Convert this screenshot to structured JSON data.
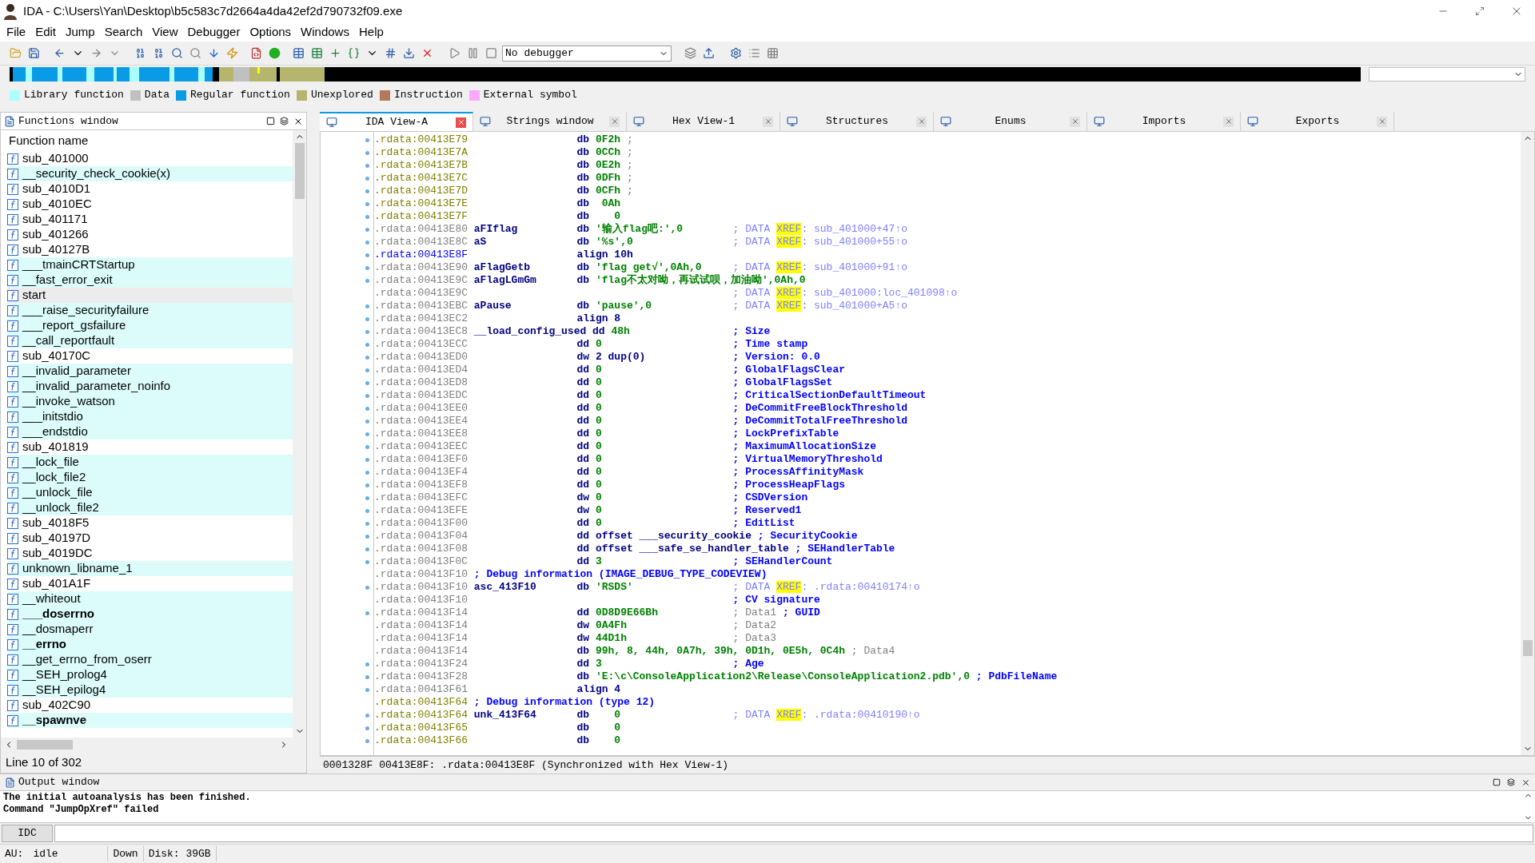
{
  "window": {
    "title": "IDA - C:\\Users\\Yan\\Desktop\\b5c583c7d2664a4da42ef2d790732f09.exe"
  },
  "menu": [
    "File",
    "Edit",
    "Jump",
    "Search",
    "View",
    "Debugger",
    "Options",
    "Windows",
    "Help"
  ],
  "toolbar": {
    "debugger_select": "No debugger"
  },
  "legend": [
    {
      "label": "Library function",
      "color": "#aaffff"
    },
    {
      "label": "Data",
      "color": "#c0c0c0"
    },
    {
      "label": "Regular function",
      "color": "#0a9be6"
    },
    {
      "label": "Unexplored",
      "color": "#b5b56e"
    },
    {
      "label": "Instruction",
      "color": "#b4785a"
    },
    {
      "label": "External symbol",
      "color": "#ffa8ff"
    }
  ],
  "functions_window": {
    "title": "Functions window",
    "column": "Function name",
    "status": "Line 10 of 302",
    "items": [
      {
        "name": "sub_401000",
        "library": false,
        "bold": false,
        "selected": false
      },
      {
        "name": "__security_check_cookie(x)",
        "library": true,
        "bold": false,
        "selected": false
      },
      {
        "name": "sub_4010D1",
        "library": false,
        "bold": false,
        "selected": false
      },
      {
        "name": "sub_4010EC",
        "library": false,
        "bold": false,
        "selected": false
      },
      {
        "name": "sub_401171",
        "library": false,
        "bold": false,
        "selected": false
      },
      {
        "name": "sub_401266",
        "library": false,
        "bold": false,
        "selected": false
      },
      {
        "name": "sub_40127B",
        "library": false,
        "bold": false,
        "selected": false
      },
      {
        "name": "___tmainCRTStartup",
        "library": true,
        "bold": false,
        "selected": false
      },
      {
        "name": "__fast_error_exit",
        "library": true,
        "bold": false,
        "selected": false
      },
      {
        "name": "start",
        "library": false,
        "bold": false,
        "selected": true
      },
      {
        "name": "___raise_securityfailure",
        "library": true,
        "bold": false,
        "selected": false
      },
      {
        "name": "___report_gsfailure",
        "library": true,
        "bold": false,
        "selected": false
      },
      {
        "name": "__call_reportfault",
        "library": true,
        "bold": false,
        "selected": false
      },
      {
        "name": "sub_40170C",
        "library": false,
        "bold": false,
        "selected": false
      },
      {
        "name": "__invalid_parameter",
        "library": true,
        "bold": false,
        "selected": false
      },
      {
        "name": "__invalid_parameter_noinfo",
        "library": true,
        "bold": false,
        "selected": false
      },
      {
        "name": "__invoke_watson",
        "library": true,
        "bold": false,
        "selected": false
      },
      {
        "name": "___initstdio",
        "library": true,
        "bold": false,
        "selected": false
      },
      {
        "name": "___endstdio",
        "library": true,
        "bold": false,
        "selected": false
      },
      {
        "name": "sub_401819",
        "library": false,
        "bold": false,
        "selected": false
      },
      {
        "name": "__lock_file",
        "library": true,
        "bold": false,
        "selected": false
      },
      {
        "name": "__lock_file2",
        "library": true,
        "bold": false,
        "selected": false
      },
      {
        "name": "__unlock_file",
        "library": true,
        "bold": false,
        "selected": false
      },
      {
        "name": "__unlock_file2",
        "library": true,
        "bold": false,
        "selected": false
      },
      {
        "name": "sub_4018F5",
        "library": false,
        "bold": false,
        "selected": false
      },
      {
        "name": "sub_40197D",
        "library": false,
        "bold": false,
        "selected": false
      },
      {
        "name": "sub_4019DC",
        "library": false,
        "bold": false,
        "selected": false
      },
      {
        "name": "unknown_libname_1",
        "library": true,
        "bold": false,
        "selected": false
      },
      {
        "name": "sub_401A1F",
        "library": false,
        "bold": false,
        "selected": false
      },
      {
        "name": "__whiteout",
        "library": true,
        "bold": false,
        "selected": false
      },
      {
        "name": "___doserrno",
        "library": true,
        "bold": true,
        "selected": false
      },
      {
        "name": "__dosmaperr",
        "library": true,
        "bold": false,
        "selected": false
      },
      {
        "name": "__errno",
        "library": true,
        "bold": true,
        "selected": false
      },
      {
        "name": "__get_errno_from_oserr",
        "library": true,
        "bold": false,
        "selected": false
      },
      {
        "name": "__SEH_prolog4",
        "library": true,
        "bold": false,
        "selected": false
      },
      {
        "name": "__SEH_epilog4",
        "library": true,
        "bold": false,
        "selected": false
      },
      {
        "name": "sub_402C90",
        "library": false,
        "bold": false,
        "selected": false
      },
      {
        "name": "__spawnve",
        "library": true,
        "bold": true,
        "selected": false
      }
    ]
  },
  "tabs": [
    {
      "label": "IDA View-A",
      "selected": true
    },
    {
      "label": "Strings window",
      "selected": false
    },
    {
      "label": "Hex View-1",
      "selected": false
    },
    {
      "label": "Structures",
      "selected": false
    },
    {
      "label": "Enums",
      "selected": false
    },
    {
      "label": "Imports",
      "selected": false
    },
    {
      "label": "Exports",
      "selected": false
    }
  ],
  "listing": {
    "status": "0001328F 00413E8F: .rdata:00413E8F (Synchronized with Hex View-1)",
    "lines": [
      {
        "addr": ".rdata:00413E79",
        "unexplored": true,
        "cursor": false,
        "marker": true,
        "mnem": "db",
        "ops": "0F2h",
        "numeric": true,
        "inline": true,
        "comment": [
          {
            "kind": "plain",
            "text": ";"
          }
        ]
      },
      {
        "addr": ".rdata:00413E7A",
        "unexplored": true,
        "cursor": false,
        "marker": true,
        "mnem": "db",
        "ops": "0CCh",
        "numeric": true,
        "inline": true,
        "comment": [
          {
            "kind": "plain",
            "text": ";"
          }
        ]
      },
      {
        "addr": ".rdata:00413E7B",
        "unexplored": true,
        "cursor": false,
        "marker": true,
        "mnem": "db",
        "ops": "0E2h",
        "numeric": true,
        "inline": true,
        "comment": [
          {
            "kind": "plain",
            "text": ";"
          }
        ]
      },
      {
        "addr": ".rdata:00413E7C",
        "unexplored": true,
        "cursor": false,
        "marker": true,
        "mnem": "db",
        "ops": "0DFh",
        "numeric": true,
        "inline": true,
        "comment": [
          {
            "kind": "plain",
            "text": ";"
          }
        ]
      },
      {
        "addr": ".rdata:00413E7D",
        "unexplored": true,
        "cursor": false,
        "marker": true,
        "mnem": "db",
        "ops": "0CFh",
        "numeric": true,
        "inline": true,
        "comment": [
          {
            "kind": "plain",
            "text": ";"
          }
        ]
      },
      {
        "addr": ".rdata:00413E7E",
        "unexplored": true,
        "cursor": false,
        "marker": true,
        "mnem": "db",
        "ops": " 0Ah",
        "numeric": true
      },
      {
        "addr": ".rdata:00413E7F",
        "unexplored": true,
        "cursor": false,
        "marker": true,
        "mnem": "db",
        "ops": "   0",
        "numeric": true
      },
      {
        "addr": ".rdata:00413E80",
        "unexplored": false,
        "cursor": false,
        "marker": true,
        "label": "aFIflag",
        "mnem": "db",
        "ops": "'输入flag吧:',0",
        "numeric": true,
        "comment": [
          {
            "kind": "xref",
            "text": "; DATA "
          },
          {
            "kind": "xref_hl",
            "text": "XREF"
          },
          {
            "kind": "xref",
            "text": ": sub_401000+47↑o"
          }
        ]
      },
      {
        "addr": ".rdata:00413E8C",
        "unexplored": false,
        "cursor": false,
        "marker": true,
        "label": "aS",
        "mnem": "db",
        "ops": "'%s',0",
        "numeric": true,
        "comment": [
          {
            "kind": "xref",
            "text": "; DATA "
          },
          {
            "kind": "xref_hl",
            "text": "XREF"
          },
          {
            "kind": "xref",
            "text": ": sub_401000+55↑o"
          }
        ]
      },
      {
        "addr": ".rdata:00413E8F",
        "unexplored": false,
        "cursor": true,
        "marker": true,
        "mnem": "align",
        "ops": "10h",
        "numeric": false
      },
      {
        "addr": ".rdata:00413E90",
        "unexplored": false,
        "cursor": false,
        "marker": true,
        "label": "aFlagGetb",
        "mnem": "db",
        "ops": "'flag get√',0Ah,0",
        "numeric": true,
        "comment": [
          {
            "kind": "xref",
            "text": "; DATA "
          },
          {
            "kind": "xref_hl",
            "text": "XREF"
          },
          {
            "kind": "xref",
            "text": ": sub_401000+91↑o"
          }
        ]
      },
      {
        "addr": ".rdata:00413E9C",
        "unexplored": false,
        "cursor": false,
        "marker": true,
        "label": "aFlagLGmGm",
        "mnem": "db",
        "ops": "'flag不太对呦，再试试呗，加油呦',0Ah,0",
        "numeric": true
      },
      {
        "addr": ".rdata:00413E9C",
        "unexplored": false,
        "cursor": false,
        "marker": false,
        "comment": [
          {
            "kind": "xref",
            "text": "; DATA "
          },
          {
            "kind": "xref_hl",
            "text": "XREF"
          },
          {
            "kind": "xref",
            "text": ": sub_401000:loc_401098↑o"
          }
        ]
      },
      {
        "addr": ".rdata:00413EBC",
        "unexplored": false,
        "cursor": false,
        "marker": true,
        "label": "aPause",
        "mnem": "db",
        "ops": "'pause',0",
        "numeric": true,
        "comment": [
          {
            "kind": "xref",
            "text": "; DATA "
          },
          {
            "kind": "xref_hl",
            "text": "XREF"
          },
          {
            "kind": "xref",
            "text": ": sub_401000+A5↑o"
          }
        ]
      },
      {
        "addr": ".rdata:00413EC2",
        "unexplored": false,
        "cursor": false,
        "marker": true,
        "mnem": "align",
        "ops": "8",
        "numeric": false
      },
      {
        "addr": ".rdata:00413EC8",
        "unexplored": false,
        "cursor": false,
        "marker": true,
        "label": "__load_config_used",
        "mnem": "dd",
        "ops": "48h",
        "numeric": true,
        "comment": [
          {
            "kind": "struct",
            "text": "; Size"
          }
        ]
      },
      {
        "addr": ".rdata:00413ECC",
        "unexplored": false,
        "cursor": false,
        "marker": true,
        "mnem": "dd",
        "ops": "0",
        "numeric": true,
        "comment": [
          {
            "kind": "struct",
            "text": "; Time stamp"
          }
        ]
      },
      {
        "addr": ".rdata:00413ED0",
        "unexplored": false,
        "cursor": false,
        "marker": true,
        "mnem": "dw",
        "ops": "2 dup(0)",
        "numeric": false,
        "comment": [
          {
            "kind": "struct",
            "text": "; Version: 0.0"
          }
        ]
      },
      {
        "addr": ".rdata:00413ED4",
        "unexplored": false,
        "cursor": false,
        "marker": true,
        "mnem": "dd",
        "ops": "0",
        "numeric": true,
        "comment": [
          {
            "kind": "struct",
            "text": "; GlobalFlagsClear"
          }
        ]
      },
      {
        "addr": ".rdata:00413ED8",
        "unexplored": false,
        "cursor": false,
        "marker": true,
        "mnem": "dd",
        "ops": "0",
        "numeric": true,
        "comment": [
          {
            "kind": "struct",
            "text": "; GlobalFlagsSet"
          }
        ]
      },
      {
        "addr": ".rdata:00413EDC",
        "unexplored": false,
        "cursor": false,
        "marker": true,
        "mnem": "dd",
        "ops": "0",
        "numeric": true,
        "comment": [
          {
            "kind": "struct",
            "text": "; CriticalSectionDefaultTimeout"
          }
        ]
      },
      {
        "addr": ".rdata:00413EE0",
        "unexplored": false,
        "cursor": false,
        "marker": true,
        "mnem": "dd",
        "ops": "0",
        "numeric": true,
        "comment": [
          {
            "kind": "struct",
            "text": "; DeCommitFreeBlockThreshold"
          }
        ]
      },
      {
        "addr": ".rdata:00413EE4",
        "unexplored": false,
        "cursor": false,
        "marker": true,
        "mnem": "dd",
        "ops": "0",
        "numeric": true,
        "comment": [
          {
            "kind": "struct",
            "text": "; DeCommitTotalFreeThreshold"
          }
        ]
      },
      {
        "addr": ".rdata:00413EE8",
        "unexplored": false,
        "cursor": false,
        "marker": true,
        "mnem": "dd",
        "ops": "0",
        "numeric": true,
        "comment": [
          {
            "kind": "struct",
            "text": "; LockPrefixTable"
          }
        ]
      },
      {
        "addr": ".rdata:00413EEC",
        "unexplored": false,
        "cursor": false,
        "marker": true,
        "mnem": "dd",
        "ops": "0",
        "numeric": true,
        "comment": [
          {
            "kind": "struct",
            "text": "; MaximumAllocationSize"
          }
        ]
      },
      {
        "addr": ".rdata:00413EF0",
        "unexplored": false,
        "cursor": false,
        "marker": true,
        "mnem": "dd",
        "ops": "0",
        "numeric": true,
        "comment": [
          {
            "kind": "struct",
            "text": "; VirtualMemoryThreshold"
          }
        ]
      },
      {
        "addr": ".rdata:00413EF4",
        "unexplored": false,
        "cursor": false,
        "marker": true,
        "mnem": "dd",
        "ops": "0",
        "numeric": true,
        "comment": [
          {
            "kind": "struct",
            "text": "; ProcessAffinityMask"
          }
        ]
      },
      {
        "addr": ".rdata:00413EF8",
        "unexplored": false,
        "cursor": false,
        "marker": true,
        "mnem": "dd",
        "ops": "0",
        "numeric": true,
        "comment": [
          {
            "kind": "struct",
            "text": "; ProcessHeapFlags"
          }
        ]
      },
      {
        "addr": ".rdata:00413EFC",
        "unexplored": false,
        "cursor": false,
        "marker": true,
        "mnem": "dw",
        "ops": "0",
        "numeric": true,
        "comment": [
          {
            "kind": "struct",
            "text": "; CSDVersion"
          }
        ]
      },
      {
        "addr": ".rdata:00413EFE",
        "unexplored": false,
        "cursor": false,
        "marker": true,
        "mnem": "dw",
        "ops": "0",
        "numeric": true,
        "comment": [
          {
            "kind": "struct",
            "text": "; Reserved1"
          }
        ]
      },
      {
        "addr": ".rdata:00413F00",
        "unexplored": false,
        "cursor": false,
        "marker": true,
        "mnem": "dd",
        "ops": "0",
        "numeric": true,
        "comment": [
          {
            "kind": "struct",
            "text": "; EditList"
          }
        ]
      },
      {
        "addr": ".rdata:00413F04",
        "unexplored": false,
        "cursor": false,
        "marker": true,
        "mnem": "dd",
        "ops": "offset ___security_cookie",
        "numeric": false,
        "inline": true,
        "comment": [
          {
            "kind": "struct",
            "text": "; SecurityCookie"
          }
        ]
      },
      {
        "addr": ".rdata:00413F08",
        "unexplored": false,
        "cursor": false,
        "marker": true,
        "mnem": "dd",
        "ops": "offset ___safe_se_handler_table",
        "numeric": false,
        "inline": true,
        "comment": [
          {
            "kind": "struct",
            "text": "; SEHandlerTable"
          }
        ]
      },
      {
        "addr": ".rdata:00413F0C",
        "unexplored": false,
        "cursor": false,
        "marker": true,
        "mnem": "dd",
        "ops": "3",
        "numeric": true,
        "comment": [
          {
            "kind": "struct",
            "text": "; SEHandlerCount"
          }
        ]
      },
      {
        "addr": ".rdata:00413F10",
        "unexplored": false,
        "cursor": false,
        "marker": false,
        "header": "; Debug information (IMAGE_DEBUG_TYPE_CODEVIEW)"
      },
      {
        "addr": ".rdata:00413F10",
        "unexplored": false,
        "cursor": false,
        "marker": true,
        "label": "asc_413F10",
        "mnem": "db",
        "ops": "'RSDS'",
        "numeric": true,
        "comment": [
          {
            "kind": "xref",
            "text": "; DATA "
          },
          {
            "kind": "xref_hl",
            "text": "XREF"
          },
          {
            "kind": "xref",
            "text": ": .rdata:00410174↑o"
          }
        ]
      },
      {
        "addr": ".rdata:00413F10",
        "unexplored": false,
        "cursor": false,
        "marker": false,
        "comment": [
          {
            "kind": "struct",
            "text": "; CV signature"
          }
        ]
      },
      {
        "addr": ".rdata:00413F14",
        "unexplored": false,
        "cursor": false,
        "marker": true,
        "mnem": "dd",
        "ops": "0D8D9E66Bh",
        "numeric": true,
        "comment": [
          {
            "kind": "plain",
            "text": "; Data1"
          },
          {
            "kind": "struct",
            "text": " ; GUID"
          }
        ]
      },
      {
        "addr": ".rdata:00413F14",
        "unexplored": false,
        "cursor": false,
        "marker": false,
        "mnem": "dw",
        "ops": "0A4Fh",
        "numeric": true,
        "comment": [
          {
            "kind": "plain",
            "text": "; Data2"
          }
        ]
      },
      {
        "addr": ".rdata:00413F14",
        "unexplored": false,
        "cursor": false,
        "marker": false,
        "mnem": "dw",
        "ops": "44D1h",
        "numeric": true,
        "comment": [
          {
            "kind": "plain",
            "text": "; Data3"
          }
        ]
      },
      {
        "addr": ".rdata:00413F14",
        "unexplored": false,
        "cursor": false,
        "marker": false,
        "mnem": "db",
        "ops": "99h, 8, 44h, 0A7h, 39h, 0D1h, 0E5h, 0C4h",
        "numeric": true,
        "inline": true,
        "comment": [
          {
            "kind": "plain",
            "text": "; Data4"
          }
        ]
      },
      {
        "addr": ".rdata:00413F24",
        "unexplored": false,
        "cursor": false,
        "marker": true,
        "mnem": "dd",
        "ops": "3",
        "numeric": true,
        "comment": [
          {
            "kind": "struct",
            "text": "; Age"
          }
        ]
      },
      {
        "addr": ".rdata:00413F28",
        "unexplored": false,
        "cursor": false,
        "marker": true,
        "mnem": "db",
        "ops": "'E:\\c\\ConsoleApplication2\\Release\\ConsoleApplication2.pdb',0",
        "numeric": true,
        "inline": true,
        "comment": [
          {
            "kind": "struct",
            "text": "; PdbFileName"
          }
        ]
      },
      {
        "addr": ".rdata:00413F61",
        "unexplored": false,
        "cursor": false,
        "marker": true,
        "mnem": "align",
        "ops": "4",
        "numeric": false
      },
      {
        "addr": ".rdata:00413F64",
        "unexplored": true,
        "cursor": false,
        "marker": false,
        "header": "; Debug information (type 12)"
      },
      {
        "addr": ".rdata:00413F64",
        "unexplored": true,
        "cursor": false,
        "marker": true,
        "label": "unk_413F64",
        "mnem": "db",
        "ops": "   0",
        "numeric": true,
        "comment": [
          {
            "kind": "xref",
            "text": "; DATA "
          },
          {
            "kind": "xref_hl",
            "text": "XREF"
          },
          {
            "kind": "xref",
            "text": ": .rdata:00410190↑o"
          }
        ]
      },
      {
        "addr": ".rdata:00413F65",
        "unexplored": true,
        "cursor": false,
        "marker": true,
        "mnem": "db",
        "ops": "   0",
        "numeric": true
      },
      {
        "addr": ".rdata:00413F66",
        "unexplored": true,
        "cursor": false,
        "marker": true,
        "mnem": "db",
        "ops": "   0",
        "numeric": true
      }
    ]
  },
  "output_window": {
    "title": "Output window",
    "lines": [
      "The initial autoanalysis has been finished.",
      "Command \"JumpOpXref\" failed"
    ],
    "idc_button": "IDC"
  },
  "status_bar": [
    "AU:",
    "idle",
    "Down",
    "Disk: 39GB"
  ]
}
